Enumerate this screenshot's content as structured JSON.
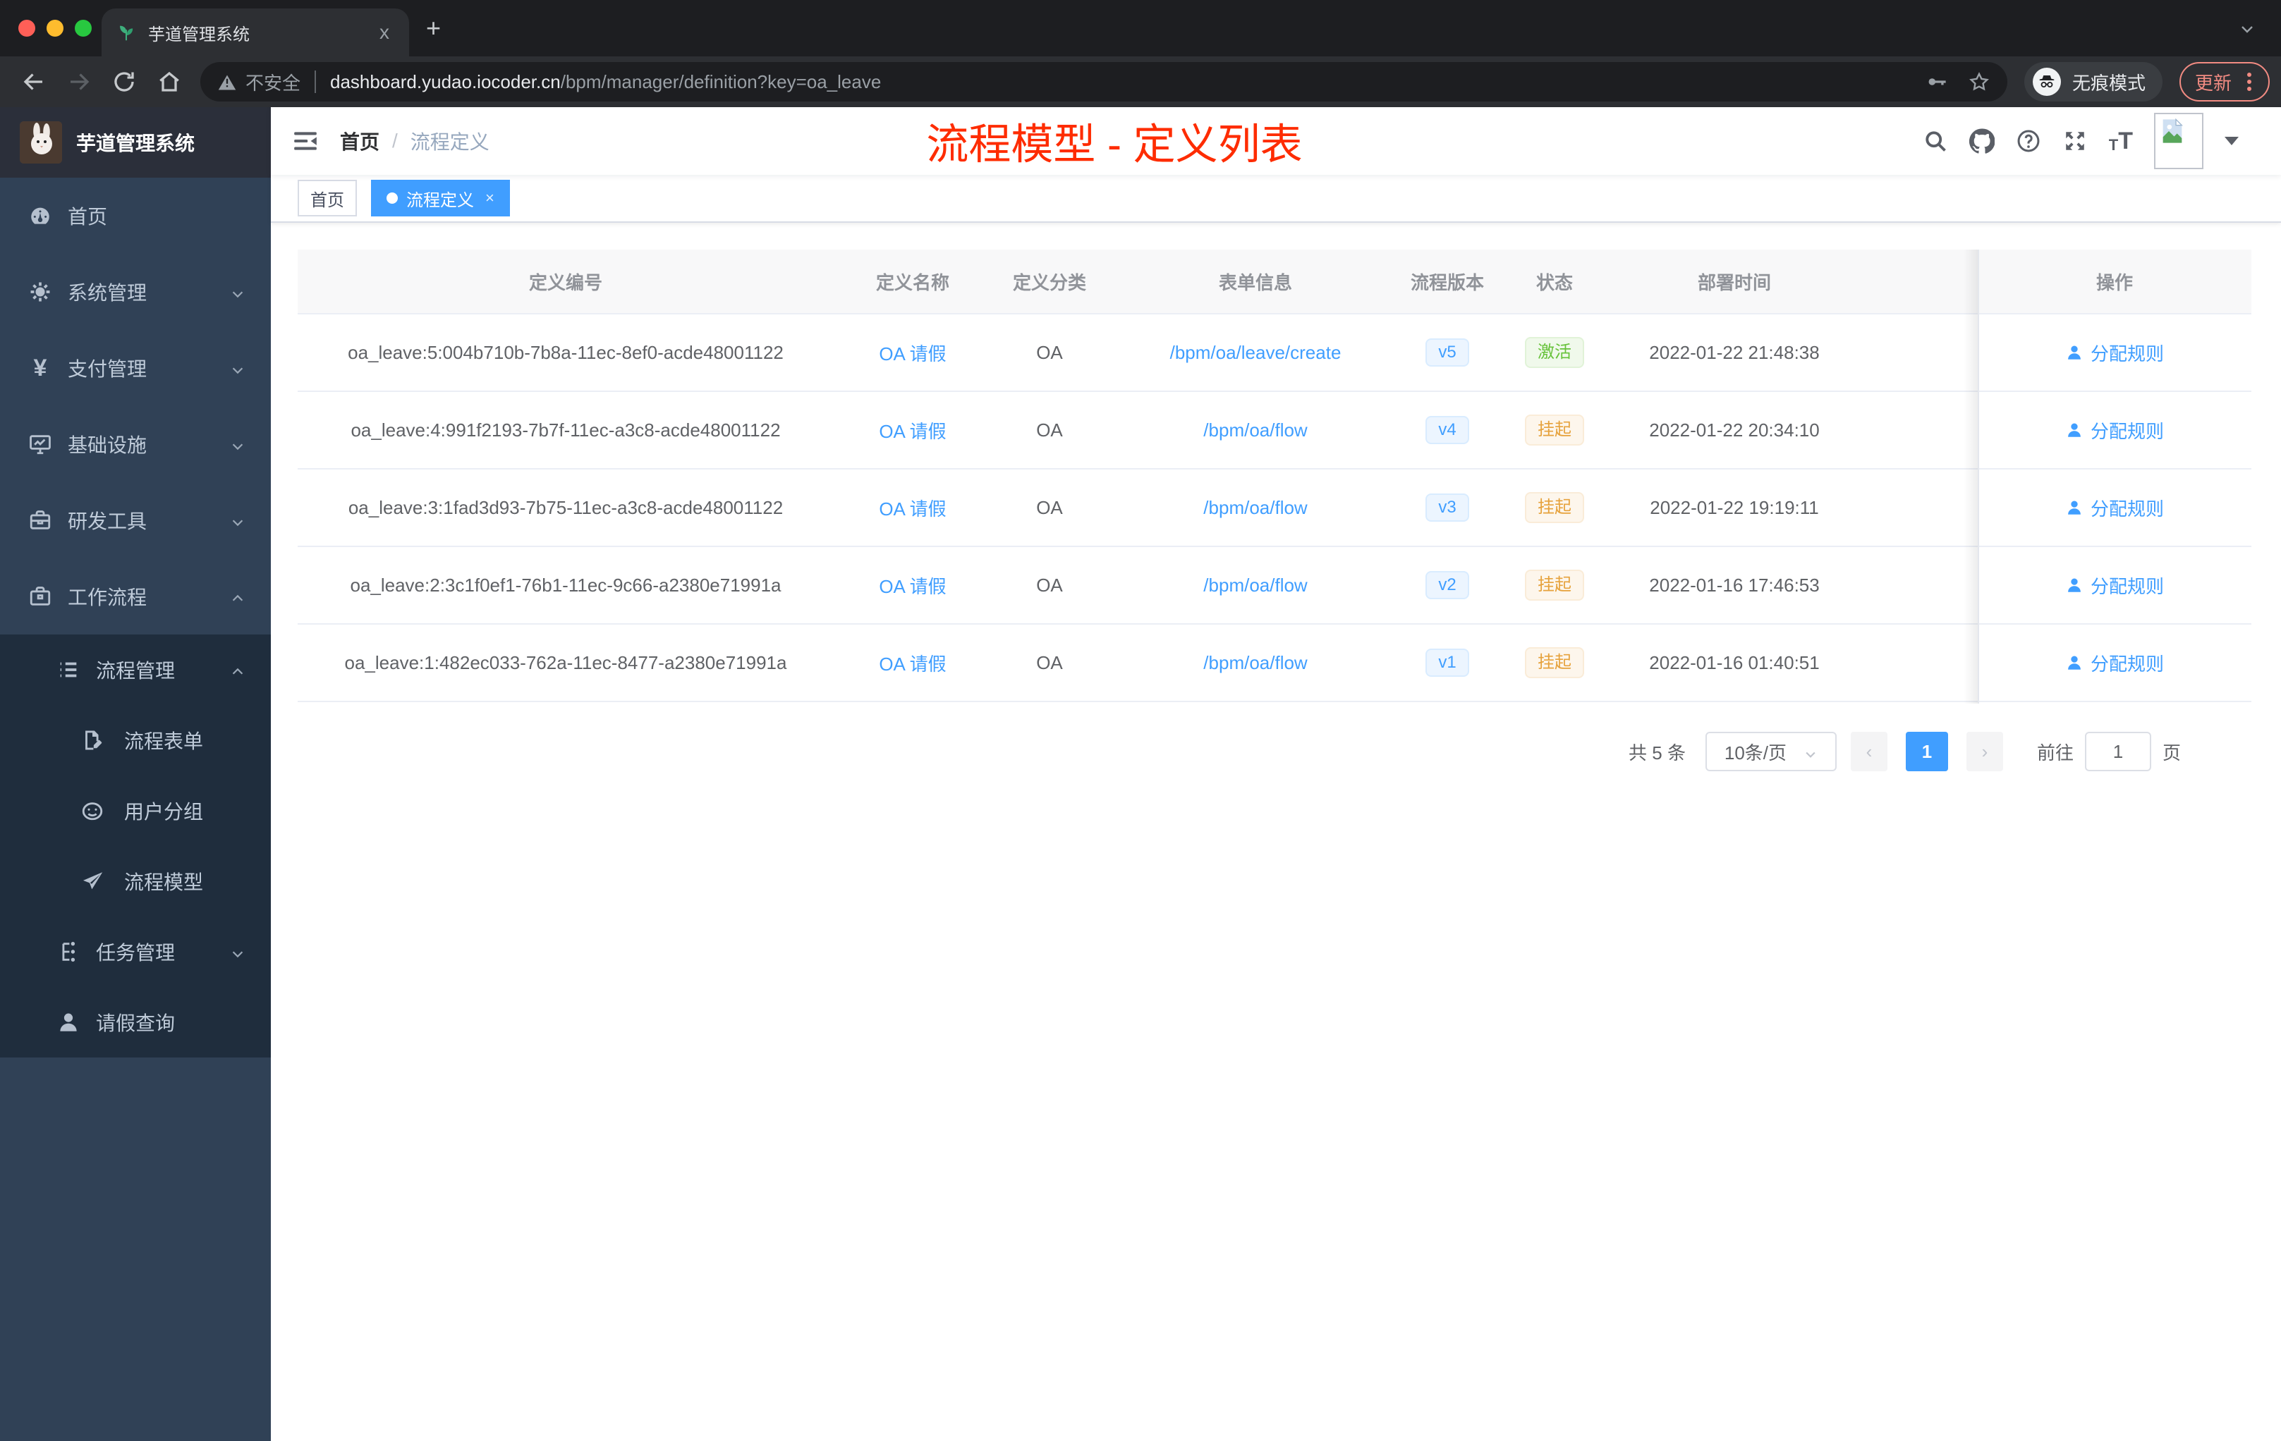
{
  "browser": {
    "tab": {
      "title": "芋道管理系统",
      "favicon": "plant-icon",
      "close_label": "x",
      "new_tab_label": "+"
    },
    "address": {
      "security_label": "不安全",
      "host": "dashboard.yudao.iocoder.cn",
      "path": "/bpm/manager/definition?key=oa_leave"
    },
    "incognito_label": "无痕模式",
    "update_label": "更新",
    "icons": [
      "back-icon",
      "forward-icon",
      "refresh-icon",
      "home-icon",
      "warning-icon",
      "key-icon",
      "star-icon",
      "incognito-icon",
      "kebab-menu-icon",
      "tab-search-chevron-icon"
    ]
  },
  "sidebar": {
    "logo_title": "芋道管理系统",
    "menu": [
      {
        "label": "首页",
        "icon": "dashboard-icon"
      },
      {
        "label": "系统管理",
        "icon": "gear-icon",
        "chevron": "down"
      },
      {
        "label": "支付管理",
        "icon": "yen-icon",
        "chevron": "down"
      },
      {
        "label": "基础设施",
        "icon": "monitor-icon",
        "chevron": "down"
      },
      {
        "label": "研发工具",
        "icon": "toolbox-icon",
        "chevron": "down"
      },
      {
        "label": "工作流程",
        "icon": "briefcase-icon",
        "chevron": "up"
      }
    ],
    "submenu": [
      {
        "label": "流程管理",
        "icon": "list-icon",
        "chevron": "up"
      },
      {
        "label": "流程表单",
        "icon": "form-icon"
      },
      {
        "label": "用户分组",
        "icon": "robot-icon"
      },
      {
        "label": "流程模型",
        "icon": "send-icon"
      },
      {
        "label": "任务管理",
        "icon": "tree-icon",
        "chevron": "down"
      },
      {
        "label": "请假查询",
        "icon": "person-icon"
      }
    ]
  },
  "header": {
    "breadcrumb": [
      "首页",
      "流程定义"
    ],
    "breadcrumb_separator": "/",
    "annotation": "流程模型 - 定义列表",
    "icons": [
      "search-icon",
      "github-icon",
      "help-icon",
      "fullscreen-icon",
      "font-size-icon",
      "avatar",
      "caret-down-icon"
    ]
  },
  "tags": [
    {
      "label": "首页",
      "active": false
    },
    {
      "label": "流程定义",
      "active": true,
      "closable": true,
      "close_label": "×"
    }
  ],
  "table": {
    "columns": [
      "定义编号",
      "定义名称",
      "定义分类",
      "表单信息",
      "流程版本",
      "状态",
      "部署时间",
      "操作"
    ],
    "action_label": "分配规则",
    "rows": [
      {
        "id": "oa_leave:5:004b710b-7b8a-11ec-8ef0-acde48001122",
        "name": "OA 请假",
        "category": "OA",
        "form": "/bpm/oa/leave/create",
        "version": "v5",
        "status": "激活",
        "status_type": "success",
        "deploy_time": "2022-01-22 21:48:38"
      },
      {
        "id": "oa_leave:4:991f2193-7b7f-11ec-a3c8-acde48001122",
        "name": "OA 请假",
        "category": "OA",
        "form": "/bpm/oa/flow",
        "version": "v4",
        "status": "挂起",
        "status_type": "warning",
        "deploy_time": "2022-01-22 20:34:10"
      },
      {
        "id": "oa_leave:3:1fad3d93-7b75-11ec-a3c8-acde48001122",
        "name": "OA 请假",
        "category": "OA",
        "form": "/bpm/oa/flow",
        "version": "v3",
        "status": "挂起",
        "status_type": "warning",
        "deploy_time": "2022-01-22 19:19:11"
      },
      {
        "id": "oa_leave:2:3c1f0ef1-76b1-11ec-9c66-a2380e71991a",
        "name": "OA 请假",
        "category": "OA",
        "form": "/bpm/oa/flow",
        "version": "v2",
        "status": "挂起",
        "status_type": "warning",
        "deploy_time": "2022-01-16 17:46:53"
      },
      {
        "id": "oa_leave:1:482ec033-762a-11ec-8477-a2380e71991a",
        "name": "OA 请假",
        "category": "OA",
        "form": "/bpm/oa/flow",
        "version": "v1",
        "status": "挂起",
        "status_type": "warning",
        "deploy_time": "2022-01-16 01:40:51"
      }
    ]
  },
  "pagination": {
    "total": "共 5 条",
    "page_size": "10条/页",
    "prev_label": "‹",
    "current_page": "1",
    "next_label": "›",
    "goto_label": "前往",
    "goto_value": "1",
    "page_unit": "页"
  },
  "colors": {
    "accent": "#409eff",
    "success": "#67c23a",
    "warning": "#e6a23c",
    "annotation_red": "#fe2c00",
    "sidebar_bg": "#304156",
    "submenu_bg": "#1f2d3d",
    "browser_frame": "#1d1e21"
  }
}
